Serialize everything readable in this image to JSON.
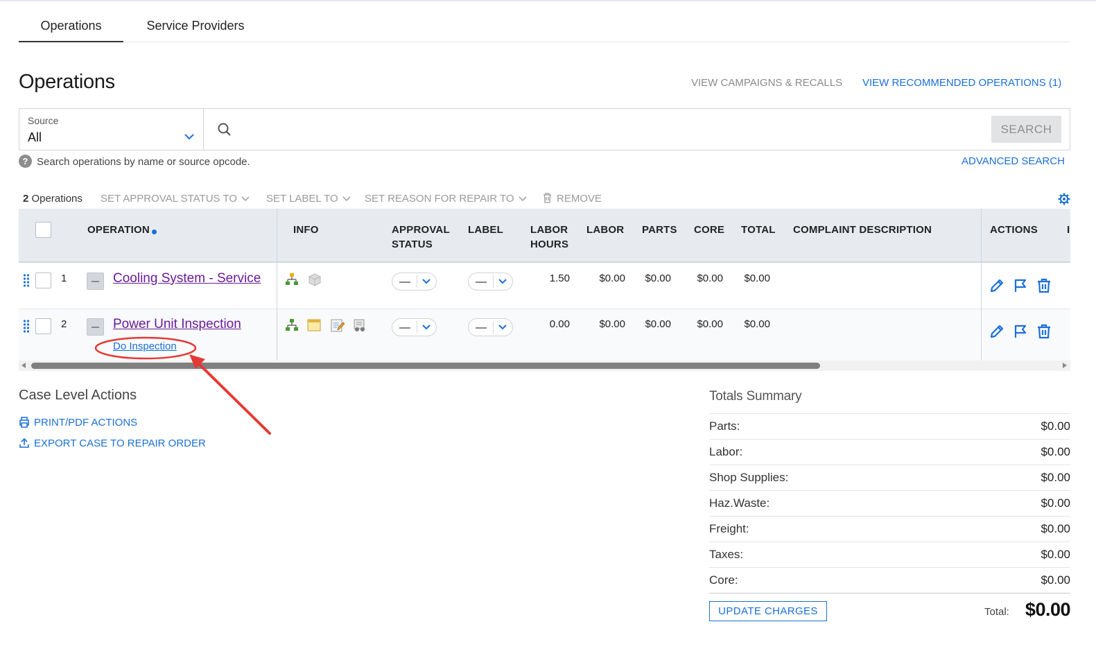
{
  "tabs": [
    {
      "label": "Operations",
      "active": true
    },
    {
      "label": "Service Providers",
      "active": false
    }
  ],
  "page_title": "Operations",
  "header_links": {
    "campaigns": "VIEW CAMPAIGNS & RECALLS",
    "recommended": "VIEW RECOMMENDED OPERATIONS (1)"
  },
  "search": {
    "source_label": "Source",
    "source_value": "All",
    "placeholder": "",
    "button": "SEARCH",
    "help": "Search operations by name or source opcode.",
    "advanced": "ADVANCED SEARCH"
  },
  "bulk": {
    "count": "2",
    "count_suffix": "Operations",
    "approval": "SET APPROVAL STATUS TO",
    "label": "SET LABEL TO",
    "reason": "SET REASON FOR REPAIR TO",
    "remove": "REMOVE"
  },
  "columns": {
    "operation": "OPERATION",
    "info": "INFO",
    "approval_1": "APPROVAL",
    "approval_2": "STATUS",
    "label": "LABEL",
    "labor_hours_1": "LABOR",
    "labor_hours_2": "HOURS",
    "labor": "LABOR",
    "parts": "PARTS",
    "core": "CORE",
    "total": "TOTAL",
    "complaint": "COMPLAINT DESCRIPTION",
    "actions": "ACTIONS",
    "truncated": "I"
  },
  "rows": [
    {
      "num": "1",
      "name": "Cooling System - Service",
      "labor_hours": "1.50",
      "labor": "$0.00",
      "parts": "$0.00",
      "core": "$0.00",
      "total": "$0.00"
    },
    {
      "num": "2",
      "name": "Power Unit Inspection",
      "sub_link": "Do Inspection",
      "labor_hours": "0.00",
      "labor": "$0.00",
      "parts": "$0.00",
      "core": "$0.00",
      "total": "$0.00"
    }
  ],
  "case_actions": {
    "title": "Case Level Actions",
    "print": "PRINT/PDF ACTIONS",
    "export": "EXPORT CASE TO REPAIR ORDER"
  },
  "totals": {
    "title": "Totals Summary",
    "items": [
      {
        "label": "Parts:",
        "value": "$0.00"
      },
      {
        "label": "Labor:",
        "value": "$0.00"
      },
      {
        "label": "Shop Supplies:",
        "value": "$0.00"
      },
      {
        "label": "Haz.Waste:",
        "value": "$0.00"
      },
      {
        "label": "Freight:",
        "value": "$0.00"
      },
      {
        "label": "Taxes:",
        "value": "$0.00"
      },
      {
        "label": "Core:",
        "value": "$0.00"
      }
    ],
    "update_button": "UPDATE CHARGES",
    "total_label": "Total:",
    "total_value": "$0.00"
  },
  "colors": {
    "accent": "#1a6fd8",
    "operation_link": "#6a1b9a",
    "annotation": "#e53935",
    "header_bg": "#e7ebf0"
  }
}
